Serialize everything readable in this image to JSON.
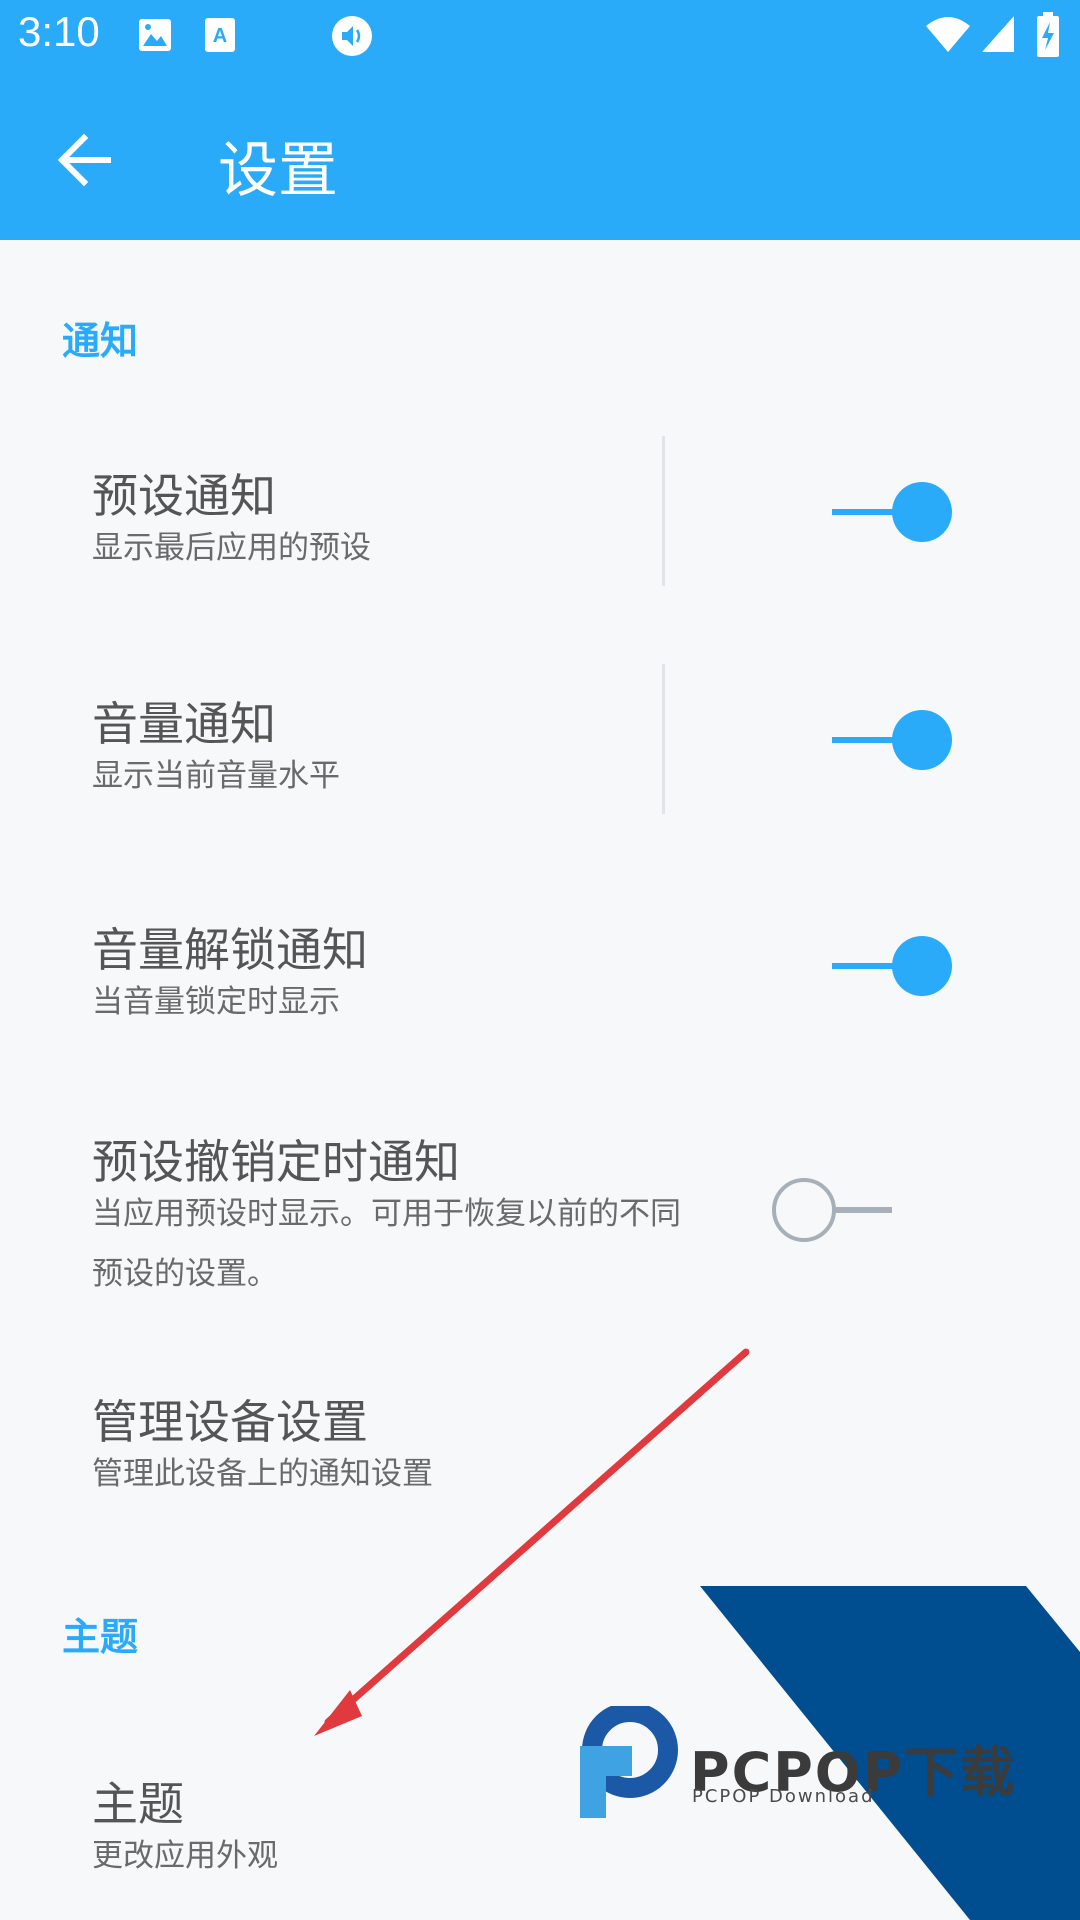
{
  "status_bar": {
    "time": "3:10",
    "icons": [
      "image-icon",
      "font-icon",
      "volume-icon",
      "wifi-icon",
      "signal-icon",
      "battery-charging-icon"
    ]
  },
  "toolbar": {
    "title": "设置",
    "back_icon": "arrow-back-icon"
  },
  "sections": {
    "notification": {
      "header": "通知",
      "items": [
        {
          "title": "预设通知",
          "summary": "显示最后应用的预设",
          "switch_on": true
        },
        {
          "title": "音量通知",
          "summary": "显示当前音量水平",
          "switch_on": true
        },
        {
          "title": "音量解锁通知",
          "summary": "当音量锁定时显示",
          "switch_on": true
        },
        {
          "title": "预设撤销定时通知",
          "summary_line1": "当应用预设时显示。可用于恢复以前的不同",
          "summary_line2": "预设的设置。",
          "switch_on": false
        },
        {
          "title": "管理设备设置",
          "summary": "管理此设备上的通知设置"
        }
      ]
    },
    "theme": {
      "header": "主题",
      "items": [
        {
          "title": "主题",
          "summary": "更改应用外观"
        }
      ]
    }
  },
  "watermark": {
    "brand": "PCPOP下载",
    "subtitle": "PCPOP Download"
  },
  "colors": {
    "accent": "#2aabf9",
    "annotation_arrow": "#e0393e",
    "watermark_blue": "#004d8f"
  }
}
